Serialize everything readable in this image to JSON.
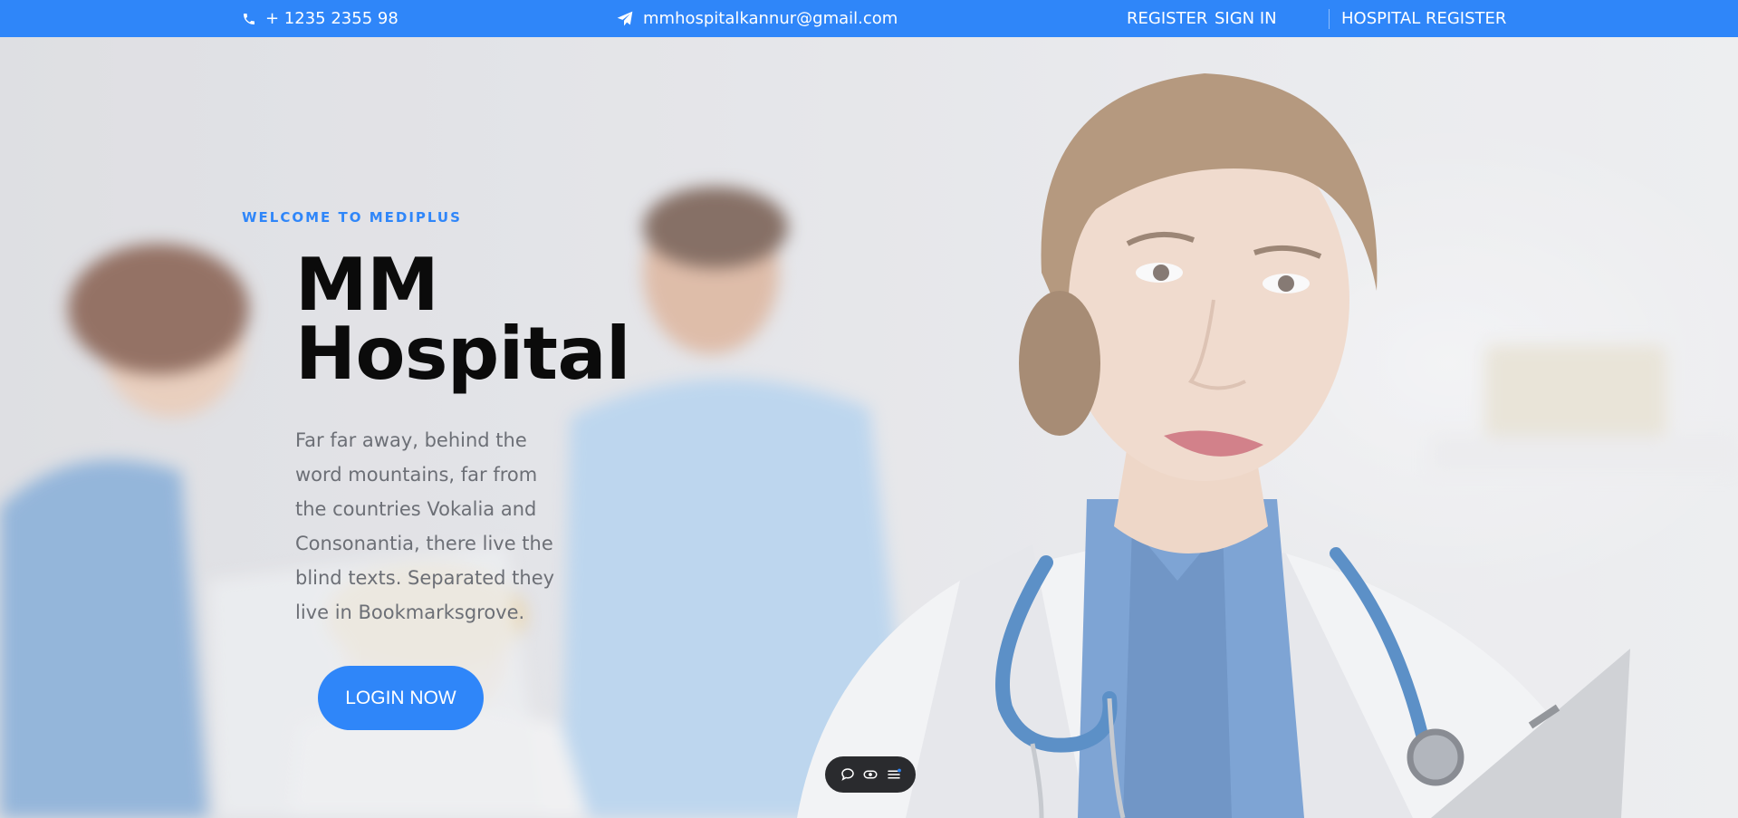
{
  "topbar": {
    "phone": "+ 1235 2355 98",
    "email": "mmhospitalkannur@gmail.com",
    "register": "REGISTER",
    "sign_in": "SIGN IN",
    "hospital_register": "HOSPITAL REGISTER",
    "icons": {
      "phone": "phone-icon",
      "email": "paper-plane-icon"
    }
  },
  "hero": {
    "eyebrow": "WELCOME TO MEDIPLUS",
    "title_line1": "MM",
    "title_line2": "Hospital",
    "description": "Far far away, behind the word mountains, far from the countries Vokalia and Consonantia, there live the blind texts. Separated they live in Bookmarksgrove.",
    "login_button": "LOGIN NOW"
  },
  "floating_toolbar": {
    "icons": [
      "chat-bubble-icon",
      "eye-icon",
      "menu-list-icon"
    ]
  },
  "colors": {
    "accent": "#2f86f9",
    "title": "#0b0b0b",
    "body_text": "#6c6f76",
    "toolbar_bg": "#2a2b2e"
  }
}
